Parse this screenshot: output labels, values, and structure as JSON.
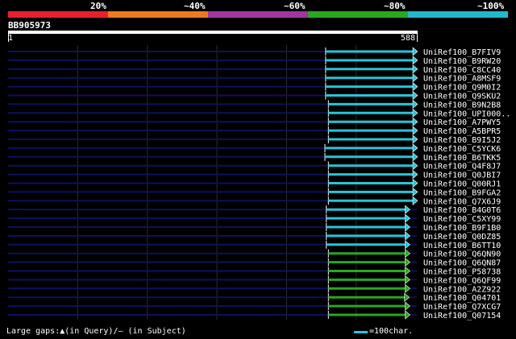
{
  "legend": {
    "labels": [
      "20%",
      "~40%",
      "~60%",
      "~80%",
      "~100%"
    ],
    "colors": [
      "#e8202c",
      "#ee7a1c",
      "#a3359e",
      "#27a81e",
      "#22b8cc"
    ]
  },
  "query": {
    "id": "BB905973",
    "start": "1",
    "end": "588",
    "length": 588
  },
  "hit_colors": {
    "cyan": "#27c4d9",
    "green": "#27a81e",
    "background_line": "#0b1260",
    "grid": "#2c2c2c"
  },
  "hits": [
    {
      "label": "UniRef100_B7FIV9",
      "start": 457,
      "end": 588,
      "color": "cyan"
    },
    {
      "label": "UniRef100_B9RW20",
      "start": 457,
      "end": 588,
      "color": "cyan"
    },
    {
      "label": "UniRef100_C8CC40",
      "start": 457,
      "end": 588,
      "color": "cyan"
    },
    {
      "label": "UniRef100_A8MSF9",
      "start": 457,
      "end": 588,
      "color": "cyan"
    },
    {
      "label": "UniRef100_Q9M0I2",
      "start": 457,
      "end": 588,
      "color": "cyan"
    },
    {
      "label": "UniRef100_Q9SKU2",
      "start": 457,
      "end": 588,
      "color": "cyan"
    },
    {
      "label": "UniRef100_B9N2B8",
      "start": 461,
      "end": 588,
      "color": "cyan"
    },
    {
      "label": "UniRef100_UPI000..",
      "start": 461,
      "end": 588,
      "color": "cyan"
    },
    {
      "label": "UniRef100_A7PWY5",
      "start": 461,
      "end": 588,
      "color": "cyan"
    },
    {
      "label": "UniRef100_A5BPR5",
      "start": 461,
      "end": 588,
      "color": "cyan"
    },
    {
      "label": "UniRef100_B9I5J2",
      "start": 461,
      "end": 588,
      "color": "cyan"
    },
    {
      "label": "UniRef100_C5YCK6",
      "start": 456,
      "end": 588,
      "color": "cyan"
    },
    {
      "label": "UniRef100_B6TKK5",
      "start": 456,
      "end": 588,
      "color": "cyan"
    },
    {
      "label": "UniRef100_Q4F8J7",
      "start": 461,
      "end": 588,
      "color": "cyan"
    },
    {
      "label": "UniRef100_Q0JBI7",
      "start": 461,
      "end": 588,
      "color": "cyan"
    },
    {
      "label": "UniRef100_Q00RJ1",
      "start": 461,
      "end": 588,
      "color": "cyan"
    },
    {
      "label": "UniRef100_B9FGA2",
      "start": 461,
      "end": 588,
      "color": "cyan"
    },
    {
      "label": "UniRef100_Q7X6J9",
      "start": 461,
      "end": 588,
      "color": "cyan"
    },
    {
      "label": "UniRef100_B4G0T6",
      "start": 458,
      "end": 577,
      "color": "cyan"
    },
    {
      "label": "UniRef100_C5XY99",
      "start": 458,
      "end": 577,
      "color": "cyan"
    },
    {
      "label": "UniRef100_B9F1B0",
      "start": 458,
      "end": 577,
      "color": "cyan"
    },
    {
      "label": "UniRef100_Q0DZ85",
      "start": 458,
      "end": 577,
      "color": "cyan"
    },
    {
      "label": "UniRef100_B6TT10",
      "start": 458,
      "end": 577,
      "color": "cyan"
    },
    {
      "label": "UniRef100_Q6QN90",
      "start": 461,
      "end": 577,
      "color": "green"
    },
    {
      "label": "UniRef100_Q6QN87",
      "start": 461,
      "end": 577,
      "color": "green"
    },
    {
      "label": "UniRef100_P58738",
      "start": 461,
      "end": 577,
      "color": "green"
    },
    {
      "label": "UniRef100_Q6QF99",
      "start": 461,
      "end": 577,
      "color": "green"
    },
    {
      "label": "UniRef100_A2Z922",
      "start": 461,
      "end": 577,
      "color": "green"
    },
    {
      "label": "UniRef100_Q04701",
      "start": 461,
      "end": 576,
      "color": "green"
    },
    {
      "label": "UniRef100_Q7XCG7",
      "start": 461,
      "end": 577,
      "color": "green"
    },
    {
      "label": "UniRef100_Q07154",
      "start": 461,
      "end": 577,
      "color": "green"
    }
  ],
  "footer": {
    "gaps_text": "Large gaps:▲(in Query)/– (in Subject)",
    "scale_text": "=100char."
  }
}
